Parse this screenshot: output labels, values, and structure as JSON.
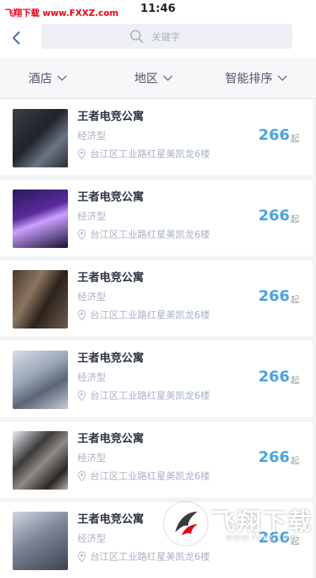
{
  "watermark_top": "飞翔下载 www.FXXZ.com",
  "status_bar": {
    "time": "11:46"
  },
  "search": {
    "placeholder": "关键字"
  },
  "filters": {
    "hotel": "酒店",
    "area": "地区",
    "sort": "智能排序"
  },
  "listings": [
    {
      "name": "王者电竞公寓",
      "type": "经济型",
      "address": "台江区工业路红星美凯龙6楼",
      "price": "266",
      "suffix": "起"
    },
    {
      "name": "王者电竞公寓",
      "type": "经济型",
      "address": "台江区工业路红星美凯龙6楼",
      "price": "266",
      "suffix": "起"
    },
    {
      "name": "王者电竞公寓",
      "type": "经济型",
      "address": "台江区工业路红星美凯龙6楼",
      "price": "266",
      "suffix": "起"
    },
    {
      "name": "王者电竞公寓",
      "type": "经济型",
      "address": "台江区工业路红星美凯龙6楼",
      "price": "266",
      "suffix": "起"
    },
    {
      "name": "王者电竞公寓",
      "type": "经济型",
      "address": "台江区工业路红星美凯龙6楼",
      "price": "266",
      "suffix": "起"
    },
    {
      "name": "王者电竞公寓",
      "type": "经济型",
      "address": "台江区工业路红星美凯龙6楼",
      "price": "266",
      "suffix": "起"
    }
  ],
  "watermark_badge": {
    "text": "飞翔下载",
    "url": "www.fxxz.com"
  }
}
